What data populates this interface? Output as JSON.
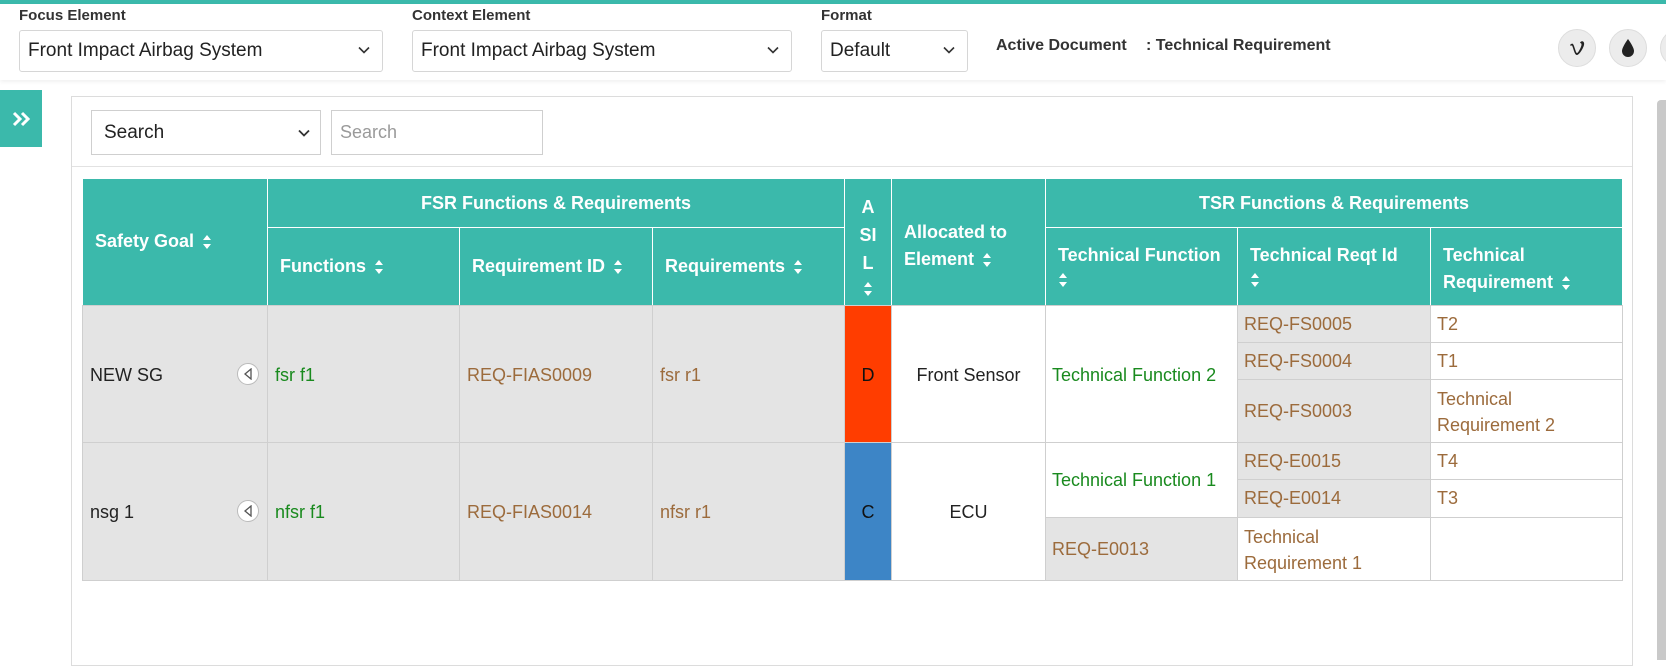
{
  "toolbar": {
    "focus_label": "Focus Element",
    "focus_value": "Front Impact Airbag System",
    "context_label": "Context Element",
    "context_value": "Front Impact Airbag System",
    "format_label": "Format",
    "format_value": "Default",
    "active_doc_label": "Active Document",
    "active_doc_value": ": Technical Requirement",
    "icons": [
      "vimeo-icon",
      "water-drop-icon"
    ]
  },
  "search": {
    "field_value": "Search",
    "placeholder": "Search"
  },
  "table": {
    "headers": {
      "safety_goal": "Safety Goal",
      "fsr_group": "FSR Functions & Requirements",
      "functions": "Functions",
      "requirement_id": "Requirement ID",
      "requirements": "Requirements",
      "asil_a": "A",
      "asil_si": "SI",
      "asil_l": "L",
      "allocated_1": "Allocated to",
      "allocated_2": "Element",
      "tsr_group": "TSR Functions & Requirements",
      "technical_function": "Technical Function",
      "technical_reqt_id": "Technical Reqt Id",
      "technical_requirement_1": "Technical",
      "technical_requirement_2": "Requirement"
    },
    "rows": [
      {
        "safety_goal": "NEW SG",
        "function": "fsr f1",
        "requirement_id": "REQ-FIAS0009",
        "requirement": "fsr r1",
        "asil": "D",
        "asil_color": "#ff3d00",
        "allocated": "Front Sensor",
        "technical_function": "Technical Function 2",
        "tech": [
          {
            "id": "REQ-FS0005",
            "req": "T2"
          },
          {
            "id": "REQ-FS0004",
            "req": "T1"
          },
          {
            "id": "REQ-FS0003",
            "req_1": "Technical",
            "req_2": "Requirement 2"
          }
        ]
      },
      {
        "safety_goal": "nsg 1",
        "function": "nfsr f1",
        "requirement_id": "REQ-FIAS0014",
        "requirement": "nfsr r1",
        "asil": "C",
        "asil_color": "#3d85c6",
        "allocated": "ECU",
        "technical_function": "Technical Function 1",
        "tech": [
          {
            "id": "REQ-E0015",
            "req": "T4"
          },
          {
            "id": "REQ-E0014",
            "req": "T3"
          },
          {
            "id": "REQ-E0013",
            "req_1": "Technical",
            "req_2": "Requirement 1"
          }
        ]
      }
    ]
  }
}
